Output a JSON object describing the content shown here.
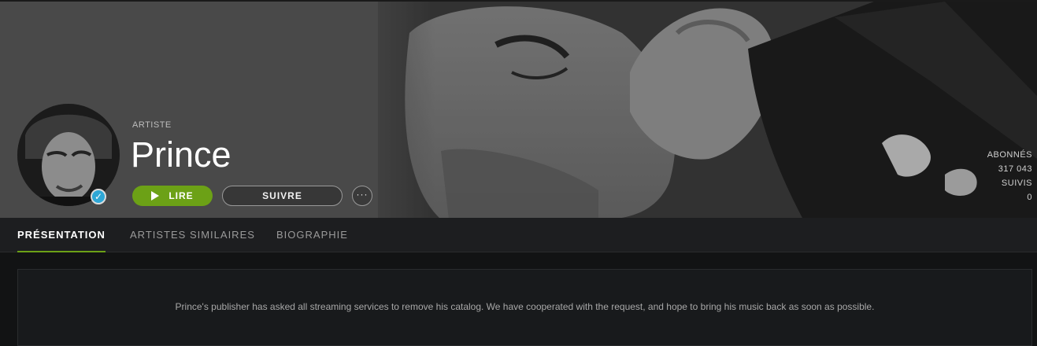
{
  "artist": {
    "type_label": "ARTISTE",
    "name": "Prince",
    "verified_mark": "✓"
  },
  "actions": {
    "play_label": "LIRE",
    "follow_label": "SUIVRE",
    "more_label": "···"
  },
  "stats": {
    "followers_label": "ABONNÉS",
    "followers_value": "317 043",
    "following_label": "SUIVIS",
    "following_value": "0"
  },
  "tabs": [
    {
      "label": "PRÉSENTATION",
      "active": true
    },
    {
      "label": "ARTISTES SIMILAIRES",
      "active": false
    },
    {
      "label": "BIOGRAPHIE",
      "active": false
    }
  ],
  "notice": {
    "text": "Prince's publisher has asked all streaming services to remove his catalog. We have cooperated with the request, and hope to bring his music back as soon as possible."
  },
  "colors": {
    "accent_green": "#6ca116",
    "verified_blue": "#2ea7d6",
    "background": "#121314"
  },
  "icons": {
    "play": "play-icon",
    "more": "more-icon",
    "verified": "verified-check-icon"
  }
}
